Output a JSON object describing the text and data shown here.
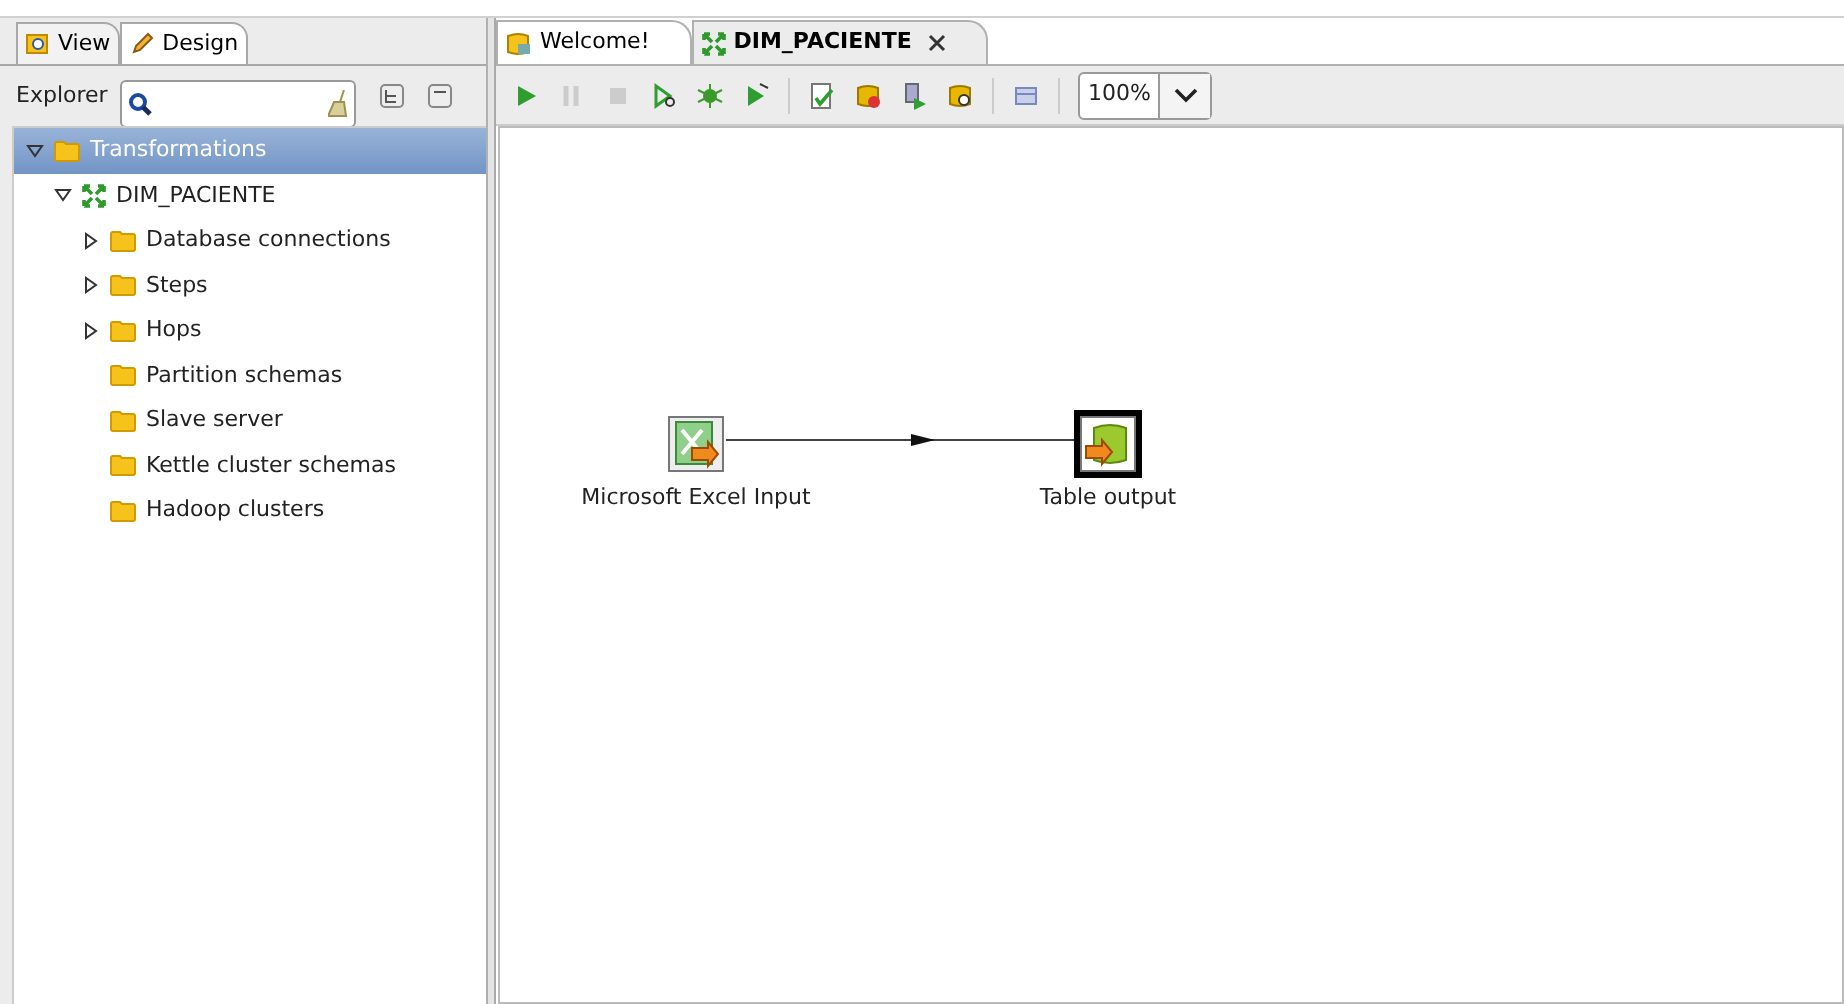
{
  "left_tabs": [
    {
      "label": "View",
      "kind": "view",
      "selected": true
    },
    {
      "label": "Design",
      "kind": "design",
      "selected": false
    }
  ],
  "explorer": {
    "label": "Explorer"
  },
  "tree": [
    {
      "label": "Transformations",
      "kind": "folder",
      "expanded": true,
      "selected": true,
      "children": [
        {
          "label": "DIM_PACIENTE",
          "kind": "transformation",
          "expanded": true,
          "selected": false,
          "children": [
            {
              "label": "Database connections",
              "kind": "folder",
              "expanded": false,
              "selected": false
            },
            {
              "label": "Steps",
              "kind": "folder",
              "expanded": false,
              "selected": false
            },
            {
              "label": "Hops",
              "kind": "folder",
              "expanded": false,
              "selected": false
            },
            {
              "label": "Partition schemas",
              "kind": "folder",
              "selected": false
            },
            {
              "label": "Slave server",
              "kind": "folder",
              "selected": false
            },
            {
              "label": "Kettle cluster schemas",
              "kind": "folder",
              "selected": false
            },
            {
              "label": "Hadoop clusters",
              "kind": "folder",
              "selected": false
            }
          ]
        }
      ]
    }
  ],
  "editor_tabs": [
    {
      "label": "Welcome!",
      "kind": "welcome",
      "selected": false
    },
    {
      "label": "DIM_PACIENTE",
      "kind": "transformation",
      "selected": true
    }
  ],
  "toolbar": {
    "zoom": "100%"
  },
  "canvas": {
    "steps": [
      {
        "label": "Microsoft Excel Input",
        "kind": "excel",
        "selected": false
      },
      {
        "label": "Table output",
        "kind": "table",
        "selected": true
      }
    ]
  }
}
